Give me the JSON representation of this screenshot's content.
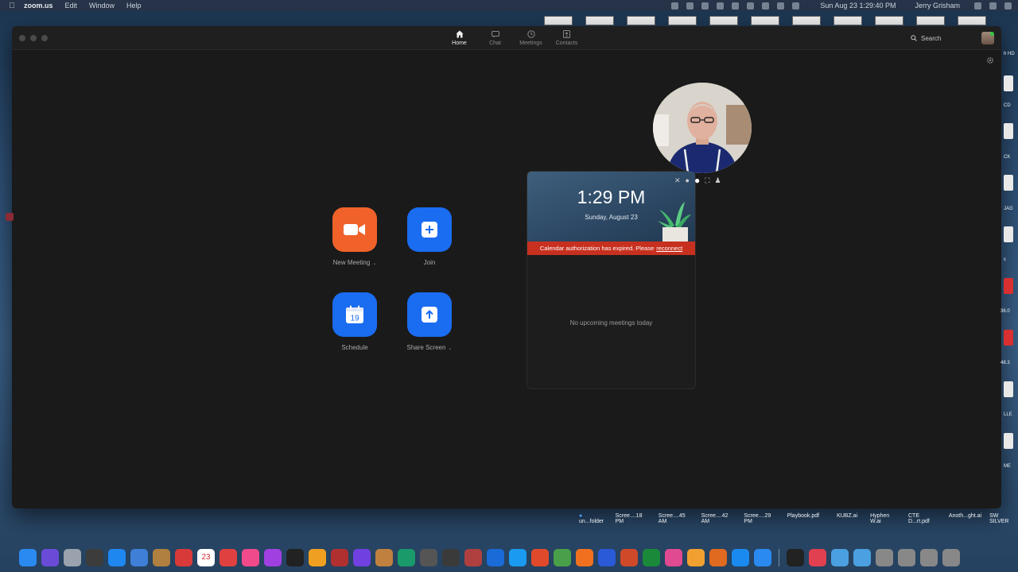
{
  "menubar": {
    "app_name": "zoom.us",
    "menus": [
      "Edit",
      "Window",
      "Help"
    ],
    "clock": "Sun Aug 23  1:29:40 PM",
    "user": "Jerry Grisham"
  },
  "zoom": {
    "tabs": [
      {
        "label": "Home",
        "icon": "home-icon"
      },
      {
        "label": "Chat",
        "icon": "chat-icon"
      },
      {
        "label": "Meetings",
        "icon": "clock-icon"
      },
      {
        "label": "Contacts",
        "icon": "contacts-icon"
      }
    ],
    "search_label": "Search",
    "actions": {
      "new_meeting": "New Meeting",
      "join": "Join",
      "schedule": "Schedule",
      "schedule_day": "19",
      "share_screen": "Share Screen"
    },
    "calendar": {
      "time": "1:29 PM",
      "date": "Sunday, August 23",
      "banner_text": "Calendar authorization has expired. Please",
      "banner_link": "reconnect",
      "empty_text": "No upcoming meetings today"
    }
  },
  "desktop": {
    "files": [
      "un...folder",
      "Scree....18 PM",
      "Scree....45 AM",
      "Scree....42 AM",
      "Scree....29 PM",
      "Playbook.pdf",
      "KUBZ.ai",
      "Hyphen W.ai",
      "CTE D...rt.pdf",
      "Anoth...ght.ai",
      "SW SILVER"
    ],
    "edge_labels": [
      "h HD",
      "CD",
      "CK",
      "JAG",
      "c",
      "36.0",
      "48.3",
      "LLE",
      "ME"
    ]
  },
  "dock": {
    "calendar_day": "23",
    "colors": [
      "#2a8af0",
      "#6a4bd8",
      "#9aa3ad",
      "#3c3c3c",
      "#1f87f0",
      "#3f7fd8",
      "#b08040",
      "#d83a3a",
      "#4a90d9",
      "#e04040",
      "#f04a8a",
      "#a040e0",
      "#222222",
      "#f0a020",
      "#b03030",
      "#7040e0",
      "#c08040",
      "#1a9a6a",
      "#555555",
      "#3a3a3a",
      "#b04040",
      "#1a6ad8",
      "#1a9af0",
      "#e04a2a",
      "#4aa04a",
      "#f07020",
      "#2a5ad8",
      "#d04a2a",
      "#1a8a3a",
      "#e04a90",
      "#f0a030",
      "#e06a20",
      "#1a8af0",
      "#2a8af0",
      "#222222",
      "#e04050",
      "#4aa0e0",
      "#4aa0e0",
      "#888888",
      "#888888",
      "#888888",
      "#888888"
    ]
  }
}
